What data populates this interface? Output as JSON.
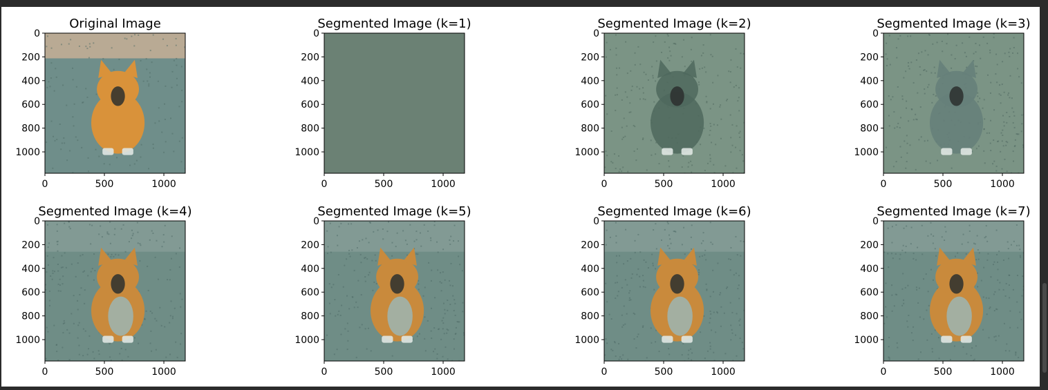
{
  "figure": {
    "panels": [
      {
        "title": "Original Image",
        "variant": "original"
      },
      {
        "title": "Segmented Image (k=1)",
        "variant": "k1"
      },
      {
        "title": "Segmented Image (k=2)",
        "variant": "k2"
      },
      {
        "title": "Segmented Image (k=3)",
        "variant": "k3"
      },
      {
        "title": "Segmented Image (k=4)",
        "variant": "seg"
      },
      {
        "title": "Segmented Image (k=5)",
        "variant": "seg"
      },
      {
        "title": "Segmented Image (k=6)",
        "variant": "seg"
      },
      {
        "title": "Segmented Image (k=7)",
        "variant": "seg"
      }
    ],
    "y_ticks": [
      "0",
      "200",
      "400",
      "600",
      "800",
      "1000"
    ],
    "x_ticks": [
      "0",
      "500",
      "1000"
    ],
    "colors": {
      "k1_fill": "#6b8174",
      "k2_fill": "#7b9485",
      "k2_cat": "#4f685d",
      "seg_bg": "#6f8d86",
      "seg_road_top": "#8aa09a",
      "cat_orange": "#c98a3c",
      "cat_gray": "#9fb2ac",
      "orig_road": "#6f8e8a",
      "orig_top": "#b9aa94",
      "orig_cat": "#d9923a"
    }
  },
  "chart_data": [
    {
      "type": "heatmap",
      "title": "Original Image",
      "xlim": [
        0,
        1180
      ],
      "ylim": [
        1180,
        0
      ],
      "x_ticks": [
        0,
        500,
        1000
      ],
      "y_ticks": [
        0,
        200,
        400,
        600,
        800,
        1000
      ]
    },
    {
      "type": "heatmap",
      "title": "Segmented Image (k=1)",
      "xlim": [
        0,
        1180
      ],
      "ylim": [
        1180,
        0
      ],
      "x_ticks": [
        0,
        500,
        1000
      ],
      "y_ticks": [
        0,
        200,
        400,
        600,
        800,
        1000
      ]
    },
    {
      "type": "heatmap",
      "title": "Segmented Image (k=2)",
      "xlim": [
        0,
        1180
      ],
      "ylim": [
        1180,
        0
      ],
      "x_ticks": [
        0,
        500,
        1000
      ],
      "y_ticks": [
        0,
        200,
        400,
        600,
        800,
        1000
      ]
    },
    {
      "type": "heatmap",
      "title": "Segmented Image (k=3)",
      "xlim": [
        0,
        1180
      ],
      "ylim": [
        1180,
        0
      ],
      "x_ticks": [
        0,
        500,
        1000
      ],
      "y_ticks": [
        0,
        200,
        400,
        600,
        800,
        1000
      ]
    },
    {
      "type": "heatmap",
      "title": "Segmented Image (k=4)",
      "xlim": [
        0,
        1180
      ],
      "ylim": [
        1180,
        0
      ],
      "x_ticks": [
        0,
        500,
        1000
      ],
      "y_ticks": [
        0,
        200,
        400,
        600,
        800,
        1000
      ]
    },
    {
      "type": "heatmap",
      "title": "Segmented Image (k=5)",
      "xlim": [
        0,
        1180
      ],
      "ylim": [
        1180,
        0
      ],
      "x_ticks": [
        0,
        500,
        1000
      ],
      "y_ticks": [
        0,
        200,
        400,
        600,
        800,
        1000
      ]
    },
    {
      "type": "heatmap",
      "title": "Segmented Image (k=6)",
      "xlim": [
        0,
        1180
      ],
      "ylim": [
        1180,
        0
      ],
      "x_ticks": [
        0,
        500,
        1000
      ],
      "y_ticks": [
        0,
        200,
        400,
        600,
        800,
        1000
      ]
    },
    {
      "type": "heatmap",
      "title": "Segmented Image (k=7)",
      "xlim": [
        0,
        1180
      ],
      "ylim": [
        1180,
        0
      ],
      "x_ticks": [
        0,
        500,
        1000
      ],
      "y_ticks": [
        0,
        200,
        400,
        600,
        800,
        1000
      ]
    }
  ]
}
